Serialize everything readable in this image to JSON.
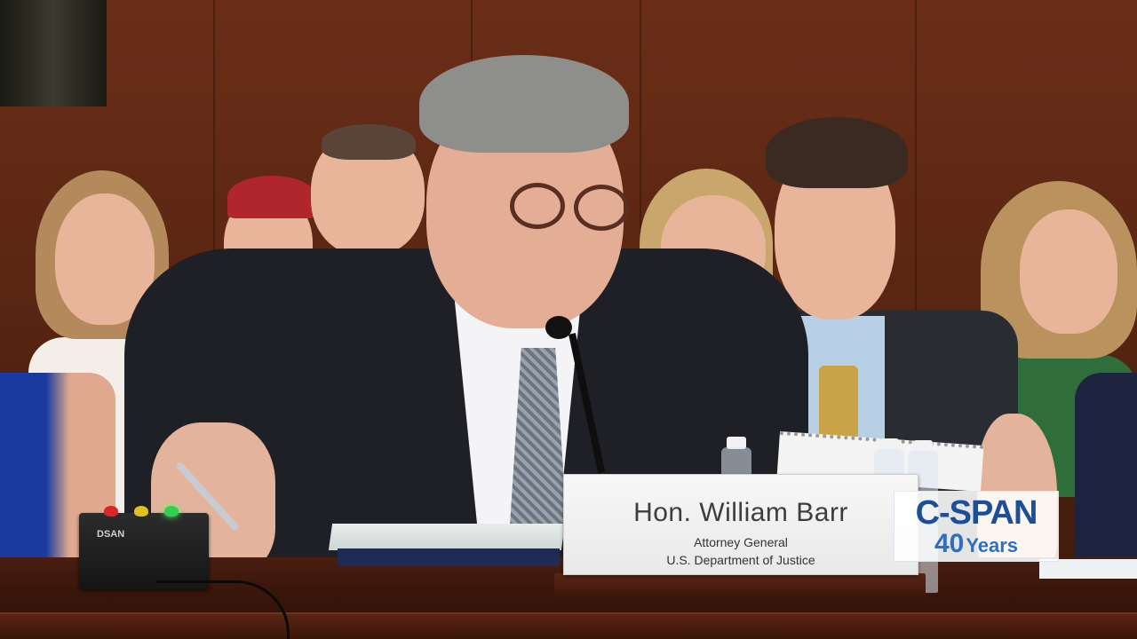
{
  "nameplate": {
    "name": "Hon. William Barr",
    "title": "Attorney General",
    "department": "U.S. Department of Justice"
  },
  "broadcast_logo": {
    "network": "C-SPAN",
    "anniversary_number": "40",
    "anniversary_word": "Years"
  },
  "timer_device": {
    "brand": "DSAN",
    "lights": [
      "red",
      "yellow",
      "green"
    ]
  },
  "colors": {
    "wood_paneling": "#5a2612",
    "cspan_blue": "#1c4f98",
    "nameplate_bg": "#f2f2f2"
  }
}
